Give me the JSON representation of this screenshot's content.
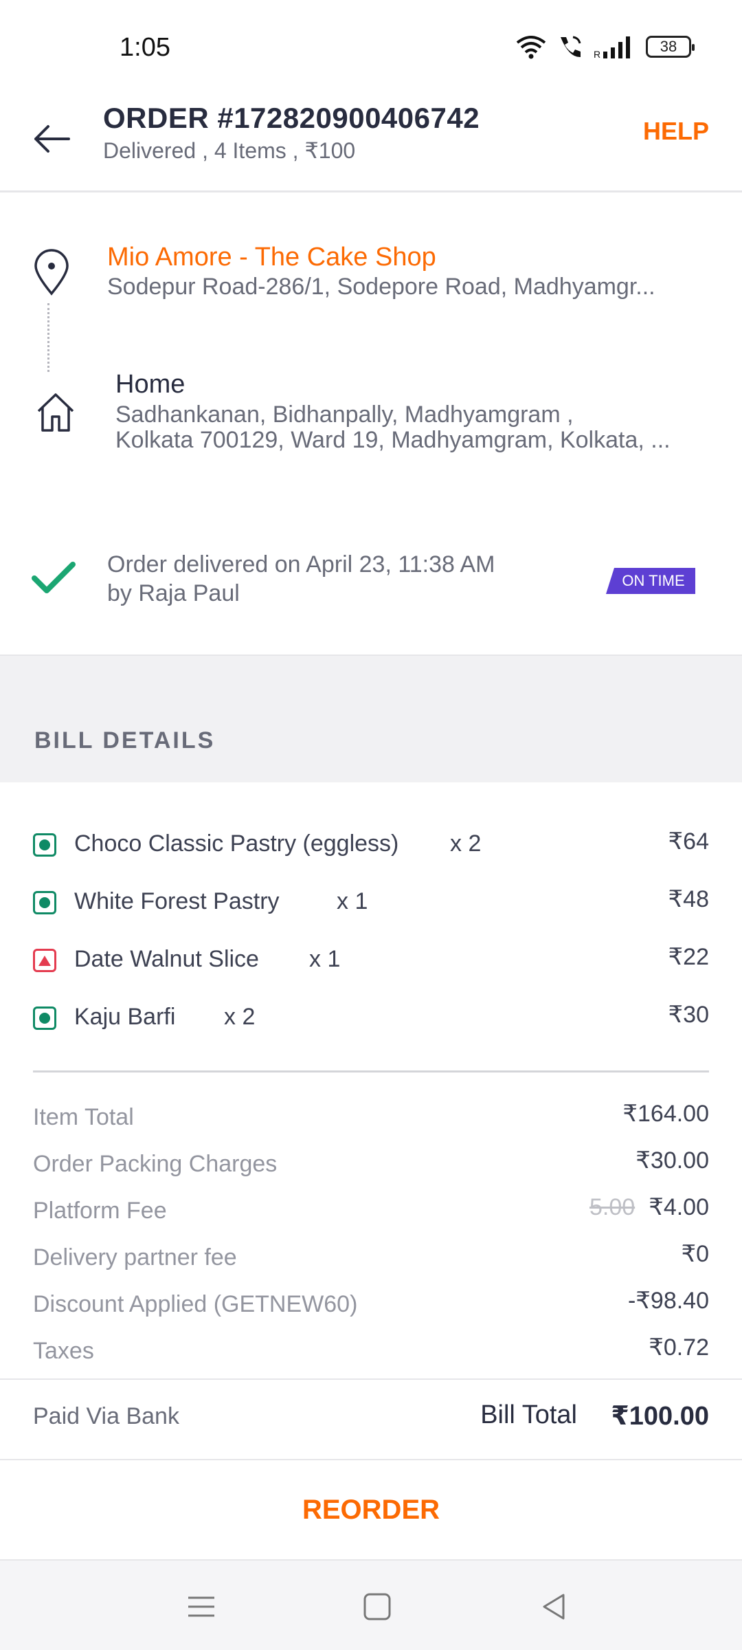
{
  "status_bar": {
    "time": "1:05",
    "battery": "38"
  },
  "header": {
    "title": "ORDER #172820900406742",
    "subtitle": "Delivered , 4 Items , ₹100",
    "help_label": "HELP"
  },
  "route": {
    "restaurant_name": "Mio Amore - The Cake Shop",
    "restaurant_address": "Sodepur Road-286/1, Sodepore Road, Madhyamgr...",
    "home_label": "Home",
    "home_address_line1": "Sadhankanan, Bidhanpally, Madhyamgram ,",
    "home_address_line2": "Kolkata 700129, Ward 19, Madhyamgram, Kolkata, ...",
    "delivery_line1": "Order delivered on April 23, 11:38 AM",
    "delivery_line2": "by Raja Paul",
    "badge": "ON TIME"
  },
  "bill": {
    "title": "BILL DETAILS",
    "items": [
      {
        "name": "Choco Classic Pastry (eggless)",
        "qty": "x 2",
        "price": "₹64",
        "type": "veg"
      },
      {
        "name": "White Forest Pastry",
        "qty": "x 1",
        "price": "₹48",
        "type": "veg"
      },
      {
        "name": "Date Walnut Slice",
        "qty": "x 1",
        "price": "₹22",
        "type": "nonveg"
      },
      {
        "name": "Kaju Barfi",
        "qty": "x 2",
        "price": "₹30",
        "type": "veg"
      }
    ],
    "charges": [
      {
        "label": "Item Total",
        "value": "₹164.00",
        "original": ""
      },
      {
        "label": "Order Packing Charges",
        "value": "₹30.00",
        "original": ""
      },
      {
        "label": "Platform Fee",
        "value": "₹4.00",
        "original": "5.00"
      },
      {
        "label": "Delivery partner fee",
        "value": "₹0",
        "original": ""
      },
      {
        "label": "Discount Applied (GETNEW60)",
        "value": "-₹98.40",
        "original": ""
      },
      {
        "label": "Taxes",
        "value": "₹0.72",
        "original": ""
      }
    ],
    "paid_via": "Paid Via Bank",
    "total_label": "Bill Total",
    "total_value": "₹100.00"
  },
  "reorder_label": "REORDER",
  "colors": {
    "accent": "#fc6a03",
    "veg": "#0f8a65",
    "nonveg": "#e43b4f",
    "badge": "#5d3fd3",
    "success": "#1ba672"
  }
}
